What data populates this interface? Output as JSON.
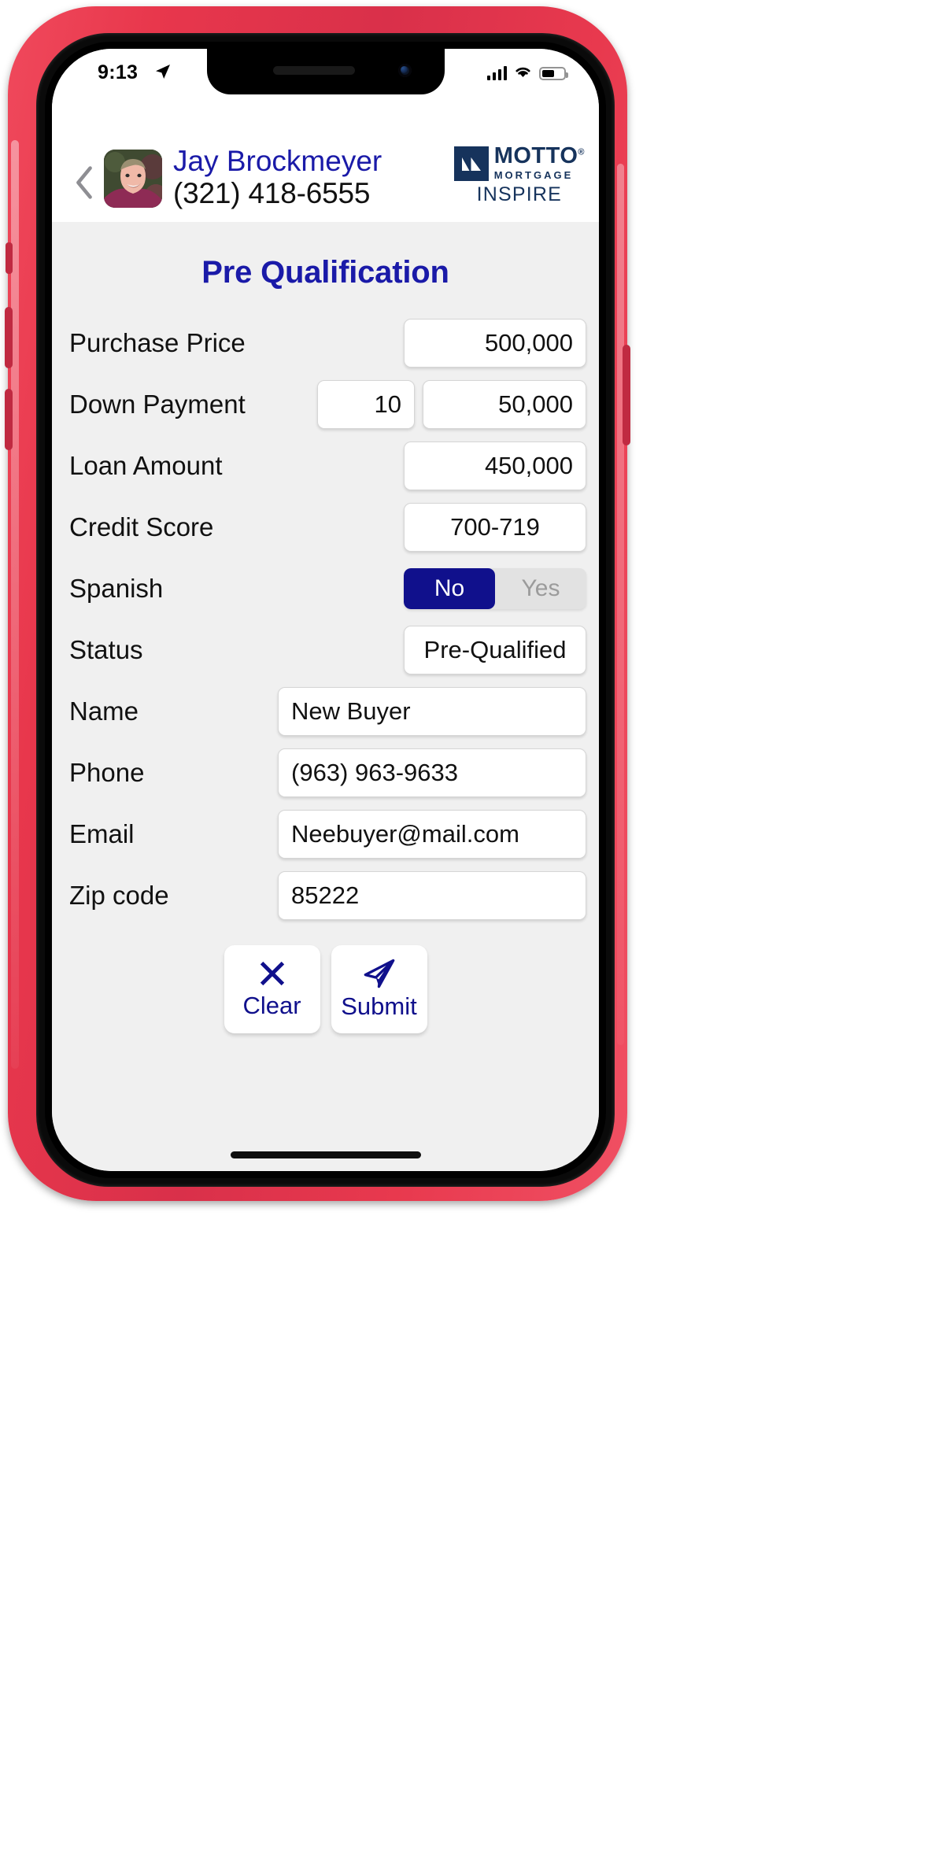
{
  "status_bar": {
    "time": "9:13",
    "location_icon": "location-arrow-icon",
    "signal_icon": "cellular-signal-icon",
    "wifi_icon": "wifi-icon",
    "battery_icon": "battery-icon"
  },
  "header": {
    "back_icon": "chevron-left-icon",
    "avatar": "agent-avatar",
    "agent_name": "Jay Brockmeyer",
    "agent_phone": "(321) 418-6555",
    "brand": {
      "mark_icon": "motto-mark-icon",
      "name": "MOTTO",
      "trademark": "®",
      "subtitle": "MORTGAGE",
      "office": "INSPIRE",
      "color": "#16335c"
    }
  },
  "main": {
    "title": "Pre Qualification",
    "title_color": "#1a1aa8",
    "accent_color": "#10108c",
    "background_color": "#f0f0f0",
    "fields": [
      {
        "label": "Purchase Price",
        "value": "500,000"
      },
      {
        "label": "Down Payment",
        "percent": "10",
        "value": "50,000"
      },
      {
        "label": "Loan Amount",
        "value": "450,000"
      },
      {
        "label": "Credit Score",
        "value": "700-719"
      },
      {
        "label": "Spanish",
        "options": [
          "No",
          "Yes"
        ],
        "selected": "No"
      },
      {
        "label": "Status",
        "value": "Pre-Qualified"
      },
      {
        "label": "Name",
        "value": "New Buyer"
      },
      {
        "label": "Phone",
        "value": "(963) 963-9633"
      },
      {
        "label": "Email",
        "value": "Neebuyer@mail.com"
      },
      {
        "label": "Zip code",
        "value": "85222"
      }
    ],
    "actions": [
      {
        "label": "Clear",
        "icon": "close-x-icon"
      },
      {
        "label": "Submit",
        "icon": "paper-plane-icon"
      }
    ]
  }
}
